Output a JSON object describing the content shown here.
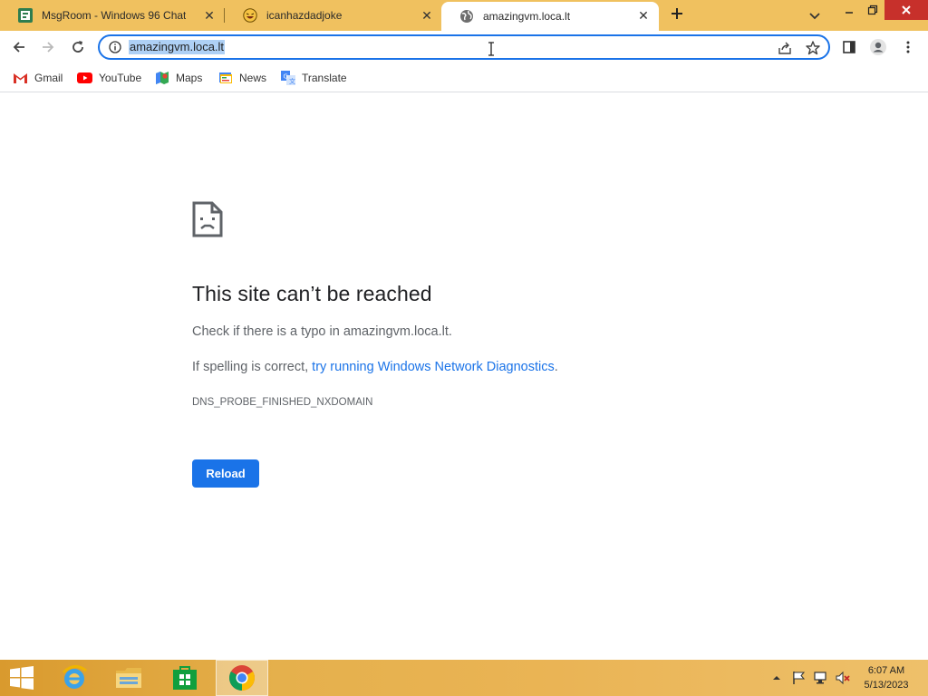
{
  "tabs": [
    {
      "title": "MsgRoom - Windows 96 Chat",
      "active": false,
      "favicon": "msgroom-icon"
    },
    {
      "title": "icanhazdadjoke",
      "active": false,
      "favicon": "laughing-face-icon"
    },
    {
      "title": "amazingvm.loca.lt",
      "active": true,
      "favicon": "globe-icon"
    }
  ],
  "omnibox": {
    "url": "amazingvm.loca.lt"
  },
  "bookmarks": [
    {
      "label": "Gmail",
      "icon": "gmail-icon"
    },
    {
      "label": "YouTube",
      "icon": "youtube-icon"
    },
    {
      "label": "Maps",
      "icon": "maps-icon"
    },
    {
      "label": "News",
      "icon": "news-icon"
    },
    {
      "label": "Translate",
      "icon": "translate-icon"
    }
  ],
  "error": {
    "title": "This site can’t be reached",
    "line1": "Check if there is a typo in amazingvm.loca.lt.",
    "line2_prefix": "If spelling is correct, ",
    "line2_link": "try running Windows Network Diagnostics",
    "line2_suffix": ".",
    "code": "DNS_PROBE_FINISHED_NXDOMAIN",
    "reload_label": "Reload"
  },
  "taskbar": {
    "time": "6:07 AM",
    "date": "5/13/2023"
  },
  "colors": {
    "tabstrip": "#f0c15f",
    "accent": "#1a73e8",
    "close_button": "#c7302b"
  }
}
